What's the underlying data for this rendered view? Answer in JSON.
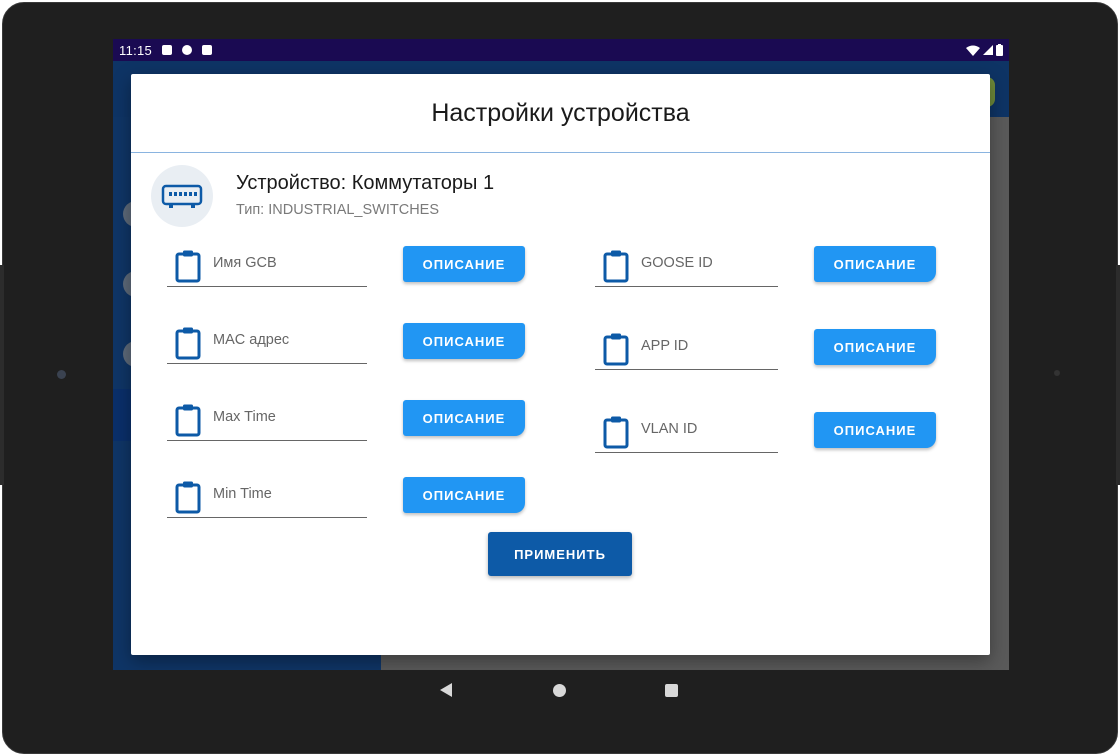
{
  "status_bar": {
    "time": "11:15"
  },
  "dialog": {
    "title": "Настройки устройства",
    "device_name": "Устройство: Коммутаторы 1",
    "device_type": "Тип: INDUSTRIAL_SWITCHES",
    "device_icon": "network-switch-icon",
    "description_button_label": "ОПИСАНИЕ",
    "apply_button_label": "ПРИМЕНИТЬ",
    "left_fields": [
      {
        "label": "Имя GCB",
        "icon": "clipboard-icon"
      },
      {
        "label": "MAC адрес",
        "icon": "clipboard-icon"
      },
      {
        "label": "Max Time",
        "icon": "clipboard-icon"
      },
      {
        "label": "Min Time",
        "icon": "clipboard-icon"
      }
    ],
    "right_fields": [
      {
        "label": "GOOSE ID",
        "icon": "clipboard-icon"
      },
      {
        "label": "APP ID",
        "icon": "clipboard-icon"
      },
      {
        "label": "VLAN ID",
        "icon": "clipboard-icon"
      }
    ]
  },
  "colors": {
    "accent": "#2196f3",
    "primary_dark": "#0d5aa7",
    "icon_blue": "#0d5aa7"
  },
  "nav_bar": {
    "icons": [
      "back-icon",
      "home-icon",
      "recent-apps-icon"
    ]
  }
}
